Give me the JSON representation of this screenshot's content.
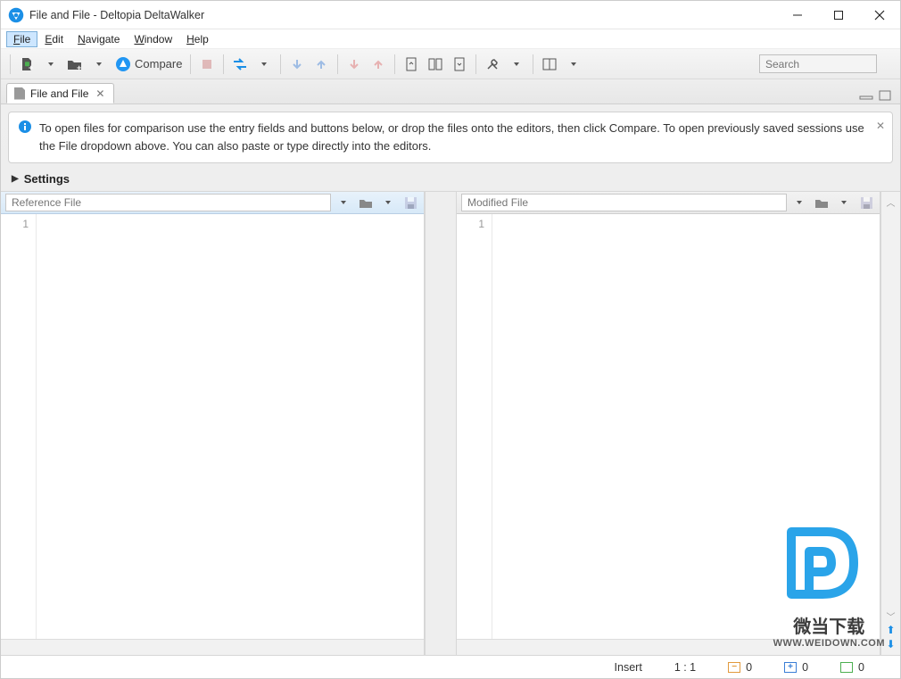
{
  "titlebar": {
    "title": "File and File - Deltopia DeltaWalker"
  },
  "menu": {
    "items": [
      {
        "label": "File",
        "accel": "F",
        "selected": true
      },
      {
        "label": "Edit",
        "accel": "E"
      },
      {
        "label": "Navigate",
        "accel": "N"
      },
      {
        "label": "Window",
        "accel": "W"
      },
      {
        "label": "Help",
        "accel": "H"
      }
    ]
  },
  "toolbar": {
    "compare_label": "Compare",
    "search_placeholder": "Search"
  },
  "tabs": {
    "items": [
      {
        "label": "File and File"
      }
    ]
  },
  "info": {
    "text": "To open files for comparison use the entry fields and buttons below, or drop the files onto the editors, then click Compare. To open previously saved sessions use the File dropdown above. You can also paste or type directly into the editors."
  },
  "settings": {
    "label": "Settings"
  },
  "panes": {
    "left": {
      "placeholder": "Reference File",
      "line": "1"
    },
    "right": {
      "placeholder": "Modified File",
      "line": "1"
    }
  },
  "status": {
    "mode": "Insert",
    "pos": "1 : 1",
    "removed": "0",
    "added": "0",
    "changed": "0"
  },
  "watermark": {
    "text1": "微当下载",
    "text2": "WWW.WEIDOWN.COM"
  }
}
